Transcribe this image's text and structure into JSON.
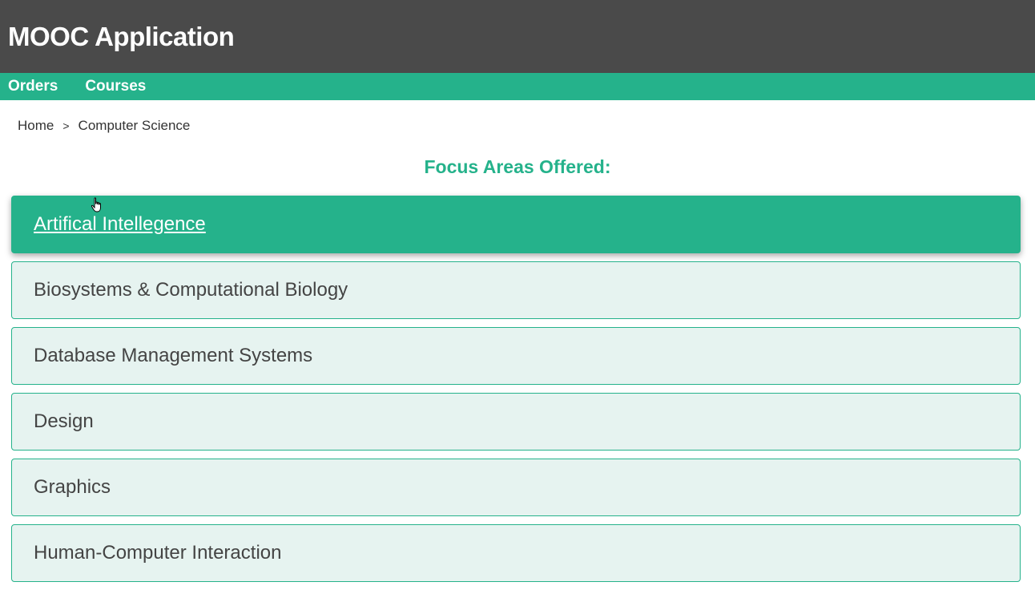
{
  "app": {
    "title": "MOOC Application"
  },
  "nav": {
    "items": [
      {
        "label": "Orders"
      },
      {
        "label": "Courses"
      }
    ]
  },
  "breadcrumb": {
    "home": "Home",
    "separator": ">",
    "current": "Computer Science"
  },
  "main": {
    "heading": "Focus Areas Offered:",
    "focus_areas": [
      {
        "label": "Artifical Intellegence",
        "active": true
      },
      {
        "label": "Biosystems & Computational Biology",
        "active": false
      },
      {
        "label": "Database Management Systems",
        "active": false
      },
      {
        "label": "Design",
        "active": false
      },
      {
        "label": "Graphics",
        "active": false
      },
      {
        "label": "Human-Computer Interaction",
        "active": false
      }
    ]
  },
  "colors": {
    "header_bg": "#4a4a4a",
    "accent": "#25b28b",
    "item_bg": "#e6f3f0"
  },
  "cursor": {
    "icon": "hand-pointer-icon"
  }
}
